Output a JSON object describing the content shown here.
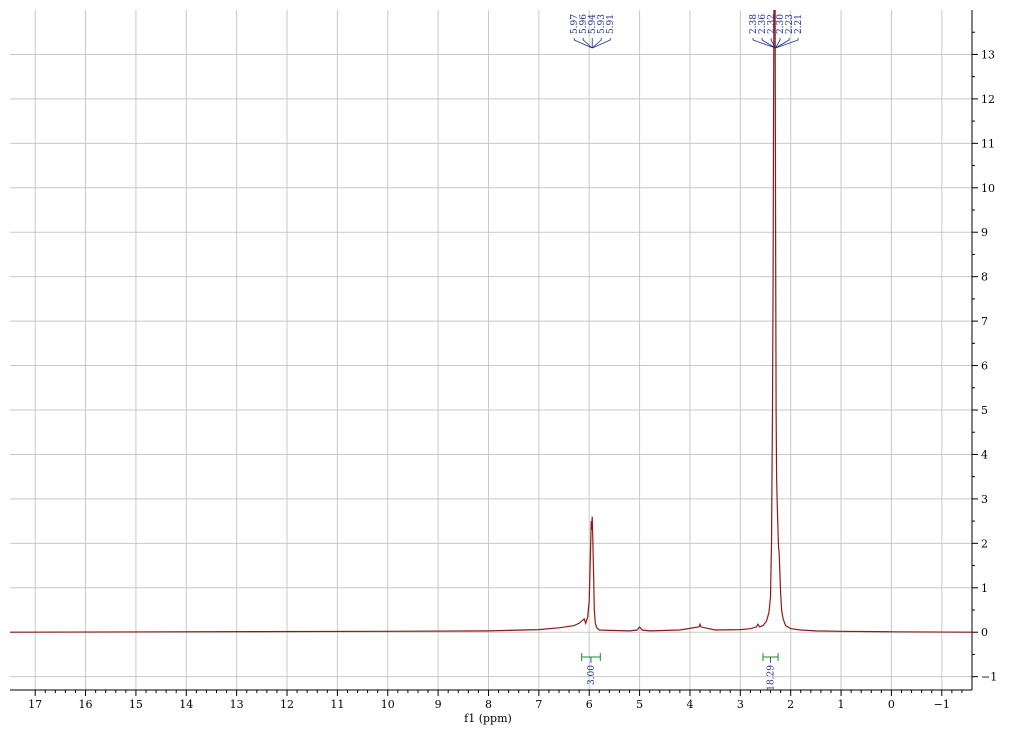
{
  "chart_data": {
    "type": "line",
    "title": "",
    "xlabel": "f1 (ppm)",
    "ylabel": "",
    "xlim": [
      17.5,
      -1.6
    ],
    "ylim": [
      -1.3,
      14
    ],
    "x_reversed": true,
    "grid": true,
    "x_ticks": [
      17,
      16,
      15,
      14,
      13,
      12,
      11,
      10,
      9,
      8,
      7,
      6,
      5,
      4,
      3,
      2,
      1,
      0,
      -1
    ],
    "y_ticks": [
      -1,
      0,
      1,
      2,
      3,
      4,
      5,
      6,
      7,
      8,
      9,
      10,
      11,
      12,
      13
    ],
    "colors": {
      "spectrum": "#8b1a1a",
      "peak_labels": "#1f2a8c",
      "integrals": "#1a8c2a",
      "grid": "#c8c8c8",
      "axis": "#000000"
    },
    "series": [
      {
        "x": [
          17.5,
          10.0,
          8.0,
          7.0,
          6.6,
          6.3,
          6.2,
          6.15,
          6.1,
          6.07,
          6.03,
          6.0,
          5.97,
          5.96,
          5.95,
          5.94,
          5.93,
          5.92,
          5.91,
          5.9,
          5.88,
          5.85,
          5.8,
          5.6,
          5.2,
          5.05,
          5.0,
          4.95,
          4.8,
          4.2,
          3.82,
          3.8,
          3.78,
          3.5,
          3.0,
          2.8,
          2.68,
          2.65,
          2.62,
          2.55,
          2.48,
          2.43,
          2.4,
          2.38,
          2.36,
          2.35,
          2.34,
          2.33,
          2.32,
          2.31,
          2.3,
          2.29,
          2.28,
          2.27,
          2.26,
          2.25,
          2.24,
          2.23,
          2.22,
          2.2,
          2.18,
          2.15,
          2.1,
          2.0,
          1.8,
          1.5,
          1.0,
          0.0,
          -1.6
        ],
        "y": [
          0,
          0.02,
          0.03,
          0.06,
          0.1,
          0.15,
          0.2,
          0.25,
          0.3,
          0.2,
          0.35,
          0.7,
          2.0,
          2.5,
          2.3,
          2.6,
          2.2,
          1.7,
          1.2,
          0.5,
          0.2,
          0.1,
          0.05,
          0.04,
          0.03,
          0.05,
          0.12,
          0.05,
          0.03,
          0.05,
          0.12,
          0.18,
          0.12,
          0.05,
          0.06,
          0.08,
          0.12,
          0.18,
          0.12,
          0.15,
          0.25,
          0.45,
          0.8,
          2.0,
          5.0,
          8.0,
          12.0,
          15.0,
          16.0,
          14.0,
          9.0,
          5.0,
          3.5,
          3.0,
          2.6,
          2.2,
          1.9,
          1.8,
          1.5,
          0.9,
          0.5,
          0.3,
          0.15,
          0.08,
          0.05,
          0.03,
          0.02,
          0.01,
          0
        ]
      }
    ],
    "peak_label_groups": [
      {
        "center": 5.94,
        "labels": [
          "5.97",
          "5.96",
          "5.94",
          "5.93",
          "5.91"
        ]
      },
      {
        "center": 2.3,
        "labels": [
          "2.38",
          "2.36",
          "2.32",
          "2.30",
          "2.23",
          "2.21"
        ]
      }
    ],
    "integrals": [
      {
        "from": 6.15,
        "to": 5.78,
        "value": "3.00"
      },
      {
        "from": 2.55,
        "to": 2.25,
        "value": "18.29"
      }
    ]
  }
}
